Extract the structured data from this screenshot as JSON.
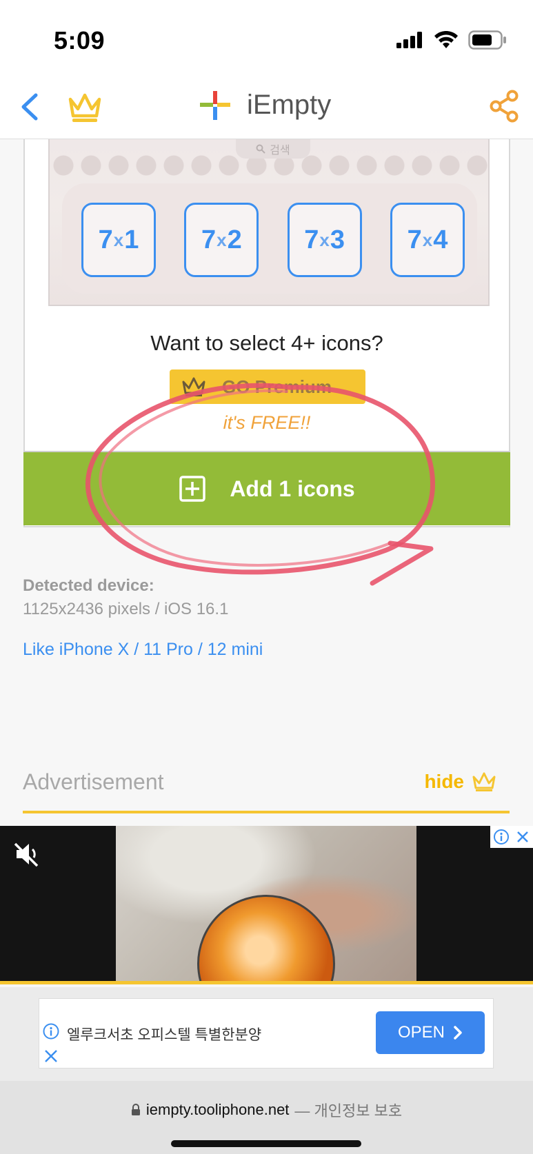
{
  "status_bar": {
    "time": "5:09",
    "icons": [
      "cellular-signal-icon",
      "wifi-icon",
      "battery-icon"
    ]
  },
  "nav": {
    "title": "iEmpty",
    "icons": [
      "back-chevron-icon",
      "crown-icon",
      "plus-logo-icon",
      "share-icon"
    ],
    "accent_color": "#3b8ff0",
    "crown_color": "#f5c531",
    "share_color": "#f0a23a"
  },
  "preview": {
    "search_label": "검색",
    "grid_options": [
      {
        "rows": "7",
        "sep": "x",
        "cols": "1"
      },
      {
        "rows": "7",
        "sep": "x",
        "cols": "2"
      },
      {
        "rows": "7",
        "sep": "x",
        "cols": "3"
      },
      {
        "rows": "7",
        "sep": "x",
        "cols": "4"
      }
    ]
  },
  "premium": {
    "question": "Want to select 4+ icons?",
    "button_label": "GO Premium",
    "free_label": "it's FREE!!",
    "button_color": "#f5c531"
  },
  "add_button": {
    "label": "Add 1 icons",
    "color": "#93bb38"
  },
  "device": {
    "detected_label": "Detected device:",
    "info": "1125x2436 pixels / iOS 16.1",
    "like": "Like iPhone X / 11 Pro / 12 mini"
  },
  "advertisement": {
    "label": "Advertisement",
    "hide_label": "hide"
  },
  "video_ad": {
    "icons": [
      "mute-icon",
      "adchoices-info-icon",
      "adchoices-close-icon"
    ]
  },
  "banner_ad": {
    "text": "엘루크서초 오피스텔 특별한분양",
    "open_label": "OPEN",
    "button_color": "#3b86ee"
  },
  "url_bar": {
    "url": "iempty.tooliphone.net",
    "secondary": "— 개인정보 보호"
  }
}
